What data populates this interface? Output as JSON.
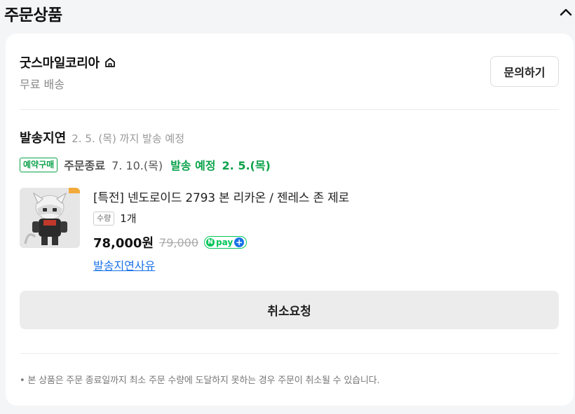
{
  "header": {
    "title": "주문상품",
    "collapse_icon": "chevron-up-icon"
  },
  "store": {
    "name": "굿스마일코리아",
    "home_icon": "home-icon",
    "shipping": "무료 배송",
    "inquiry_label": "문의하기"
  },
  "delay": {
    "title": "발송지연",
    "subtitle": "2. 5. (목) 까지 발송 예정"
  },
  "schedule": {
    "badge": "예약구매",
    "order_end_label": "주문종료",
    "order_end_date": "7. 10.(목)",
    "ship_label": "발송 예정",
    "ship_date": "2. 5.(목)"
  },
  "product": {
    "name": "[특전] 넨도로이드 2793 본 리카온 / 젠레스 존 제로",
    "qty_label": "수량",
    "qty_value": "1개",
    "price": "78,000원",
    "original_price": "79,000",
    "npay_n": "N",
    "npay_text": "pay",
    "npay_plus": "+",
    "delay_reason_link": "발송지연사유"
  },
  "actions": {
    "cancel_label": "취소요청"
  },
  "notice": "• 본 상품은 주문 종료일까지 최소 주문 수량에 도달하지 못하는 경우 주문이 취소될 수 있습니다.",
  "colors": {
    "accent_green": "#0ba24a",
    "npay_green": "#03c75a",
    "link_blue": "#1a73e8"
  }
}
